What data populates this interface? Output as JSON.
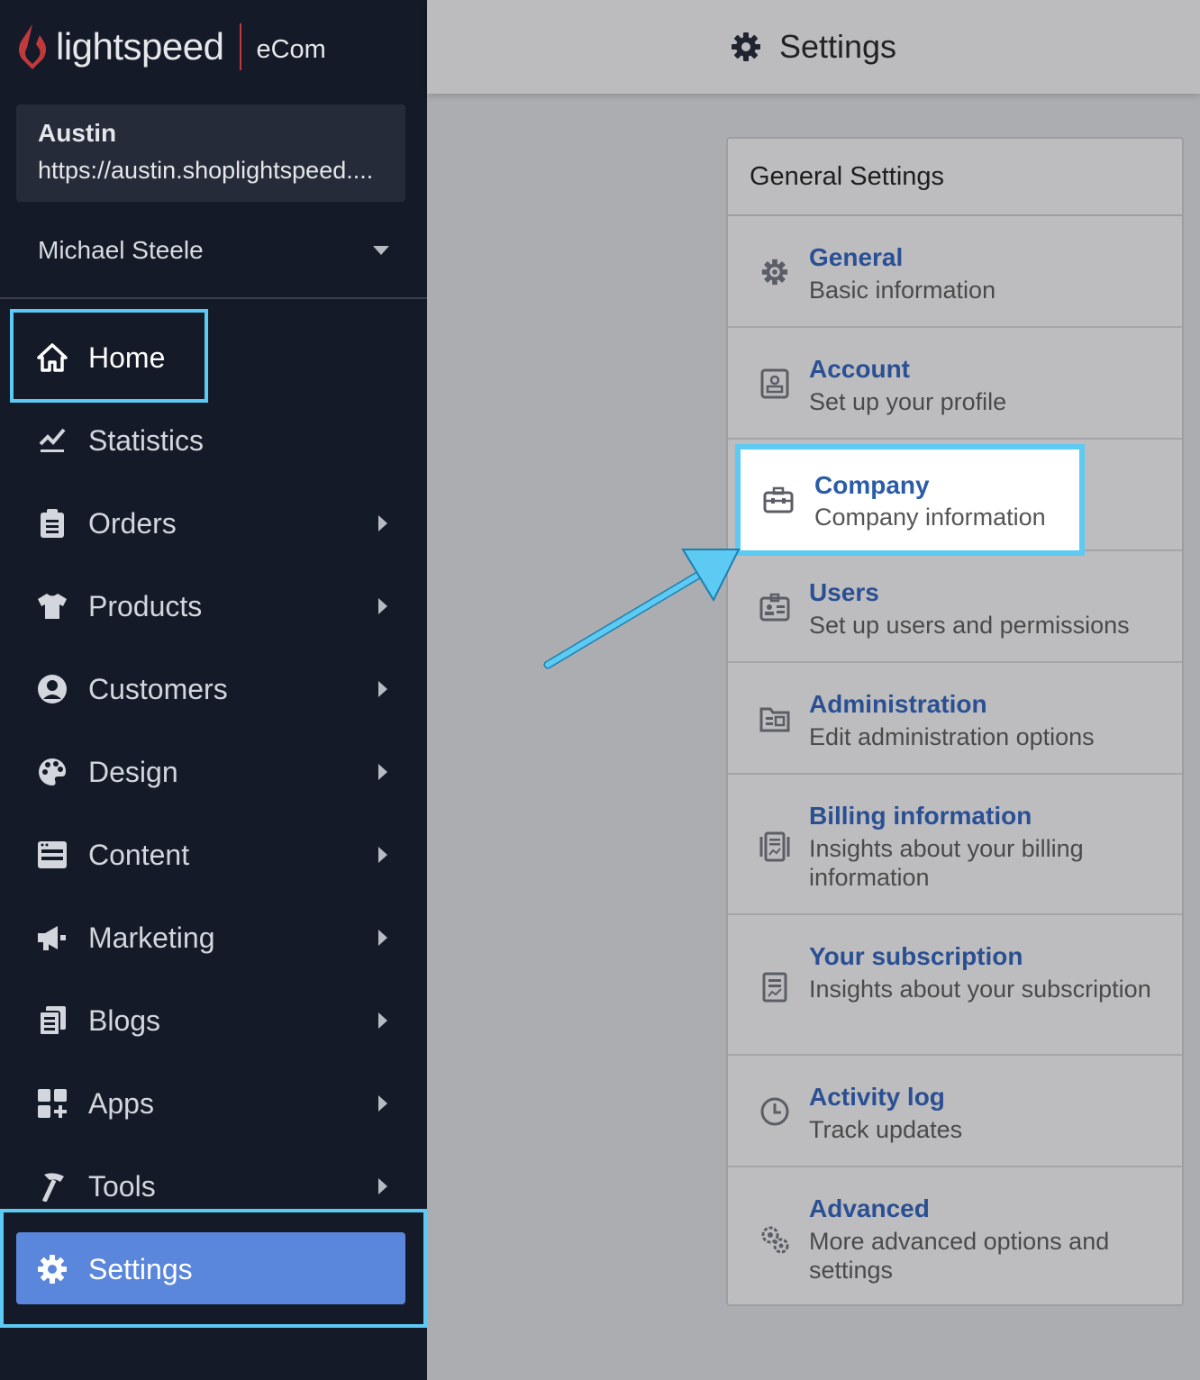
{
  "brand": {
    "logo_text": "lightspeed",
    "product": "eCom",
    "accent": "#c0393b"
  },
  "store": {
    "name": "Austin",
    "url": "https://austin.shoplightspeed...."
  },
  "user": {
    "name": "Michael Steele"
  },
  "nav": {
    "home": "Home",
    "statistics": "Statistics",
    "orders": "Orders",
    "products": "Products",
    "customers": "Customers",
    "design": "Design",
    "content": "Content",
    "marketing": "Marketing",
    "blogs": "Blogs",
    "apps": "Apps",
    "tools": "Tools",
    "settings": "Settings"
  },
  "header": {
    "title": "Settings",
    "icon": "gear-icon"
  },
  "panel": {
    "heading": "General Settings",
    "items": [
      {
        "title": "General",
        "desc": "Basic information",
        "icon": "gear-icon"
      },
      {
        "title": "Account",
        "desc": "Set up your profile",
        "icon": "account-icon"
      },
      {
        "title": "Company",
        "desc": "Company information",
        "icon": "briefcase-icon"
      },
      {
        "title": "Users",
        "desc": "Set up users and permissions",
        "icon": "users-icon"
      },
      {
        "title": "Administration",
        "desc": "Edit administration options",
        "icon": "folder-icon"
      },
      {
        "title": "Billing information",
        "desc": "Insights about your billing information",
        "icon": "billing-icon"
      },
      {
        "title": "Your subscription",
        "desc": "Insights about your subscription",
        "icon": "subscription-icon"
      },
      {
        "title": "Activity log",
        "desc": "Track updates",
        "icon": "clock-icon"
      },
      {
        "title": "Advanced",
        "desc": "More advanced options and settings",
        "icon": "gears-icon"
      }
    ]
  },
  "colors": {
    "highlight": "#5ccaf2",
    "active_nav": "#5a87dc",
    "sidebar_bg": "#151a28",
    "link": "#2a4f93"
  }
}
